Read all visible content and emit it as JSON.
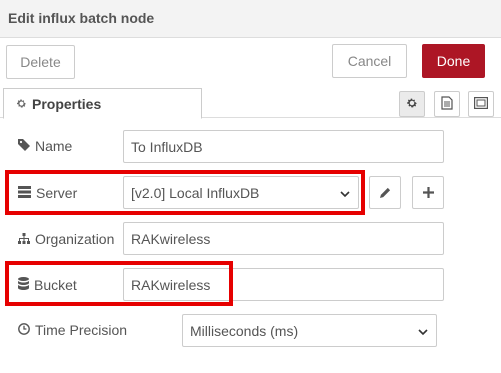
{
  "dialog": {
    "title": "Edit influx batch node",
    "delete_label": "Delete",
    "cancel_label": "Cancel",
    "done_label": "Done"
  },
  "tabs": {
    "properties_label": "Properties"
  },
  "form": {
    "name_label": "Name",
    "name_value": "To InfluxDB",
    "server_label": "Server",
    "server_value": "[v2.0] Local InfluxDB",
    "organization_label": "Organization",
    "organization_value": "RAKwireless",
    "bucket_label": "Bucket",
    "bucket_value": "RAKwireless",
    "time_precision_label": "Time Precision",
    "time_precision_value": "Milliseconds (ms)"
  },
  "icons": [
    "gear-icon",
    "description-icon",
    "appearance-icon",
    "tag-icon",
    "server-icon",
    "sitemap-icon",
    "database-icon",
    "clock-icon",
    "pencil-icon",
    "plus-icon",
    "chevron-down-icon"
  ],
  "colors": {
    "done_button": "#ad1625",
    "highlight_box": "#e60000"
  }
}
